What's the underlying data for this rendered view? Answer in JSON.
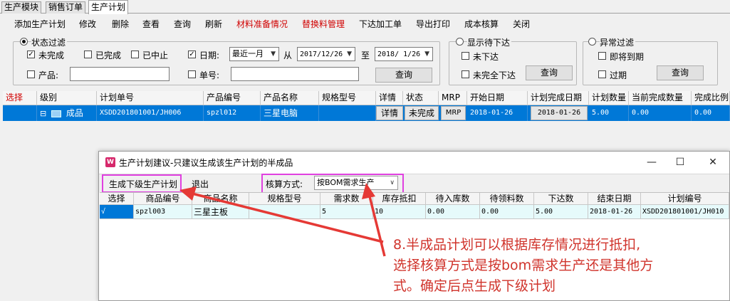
{
  "module_tabs": [
    "生产模块",
    "销售订单",
    "生产计划"
  ],
  "toolbar": [
    {
      "label": "添加生产计划",
      "red": false
    },
    {
      "label": "修改",
      "red": false
    },
    {
      "label": "删除",
      "red": false
    },
    {
      "label": "查看",
      "red": false
    },
    {
      "label": "查询",
      "red": false
    },
    {
      "label": "刷新",
      "red": false
    },
    {
      "label": "材料准备情况",
      "red": true
    },
    {
      "label": "替换料管理",
      "red": true
    },
    {
      "label": "下达加工单",
      "red": false
    },
    {
      "label": "导出打印",
      "red": false
    },
    {
      "label": "成本核算",
      "red": false
    },
    {
      "label": "关闭",
      "red": false
    }
  ],
  "status_filter": {
    "title": "状态过滤",
    "uncompleted": "未完成",
    "completed": "已完成",
    "stopped": "已中止",
    "product_label": "产品:",
    "product_value": "",
    "date_label": "日期:",
    "date_range": "最近一月",
    "from_label": "从",
    "date_from": "2017/12/26",
    "to_label": "至",
    "date_to": "2018/ 1/26",
    "order_label": "单号:",
    "order_value": "",
    "query": "查询"
  },
  "pending_filter": {
    "title": "显示待下达",
    "not_issued": "未下达",
    "partially_issued": "未完全下达",
    "query": "查询"
  },
  "exception_filter": {
    "title": "异常过滤",
    "due_soon": "即将到期",
    "overdue": "过期",
    "query": "查询"
  },
  "main_grid": {
    "columns": [
      "选择",
      "级别",
      "计划单号",
      "产品编号",
      "产品名称",
      "规格型号",
      "详情",
      "状态",
      "MRP",
      "开始日期",
      "计划完成日期",
      "计划数量",
      "当前完成数量",
      "完成比例"
    ],
    "row": {
      "select": "",
      "level_expander": "⊟",
      "level": "成品",
      "plan_no": "XSDD201801001/JH006",
      "product_code": "spzl012",
      "product_name": "三星电脑",
      "spec": "",
      "detail": "详情",
      "status": "未完成",
      "mrp": "MRP",
      "start_date": "2018-01-26",
      "plan_finish_date": "2018-01-26",
      "plan_qty": "5.00",
      "current_done_qty": "0.00",
      "done_ratio": "0.00"
    }
  },
  "dialog": {
    "title": "生产计划建议-只建议生成该生产计划的半成品",
    "btn_generate": "生成下级生产计划",
    "btn_exit": "退出",
    "calc_label": "核算方式:",
    "calc_value": "按BOM需求生产",
    "columns": [
      "选择",
      "商品编号",
      "商品名称",
      "规格型号",
      "需求数",
      "库存抵扣",
      "待入库数",
      "待领料数",
      "下达数",
      "结束日期",
      "计划编号"
    ],
    "row": {
      "select": "√",
      "code": "spzl003",
      "name": "三星主板",
      "spec": "",
      "demand": "5",
      "stock_deduct": "10",
      "pending_in": "0.00",
      "pending_pick": "0.00",
      "issue_qty": "5.00",
      "end_date": "2018-01-26",
      "plan_no": "XSDD201801001/JH010"
    }
  },
  "annotation": [
    "8.半成品计划可以根据库存情况进行抵扣,",
    "选择核算方式是按bom需求生产还是其他方",
    "式。确定后点生成下级计划"
  ],
  "colors": {
    "accent": "#0078d7",
    "highlight": "#e040e0",
    "annotation": "#d0342c"
  }
}
